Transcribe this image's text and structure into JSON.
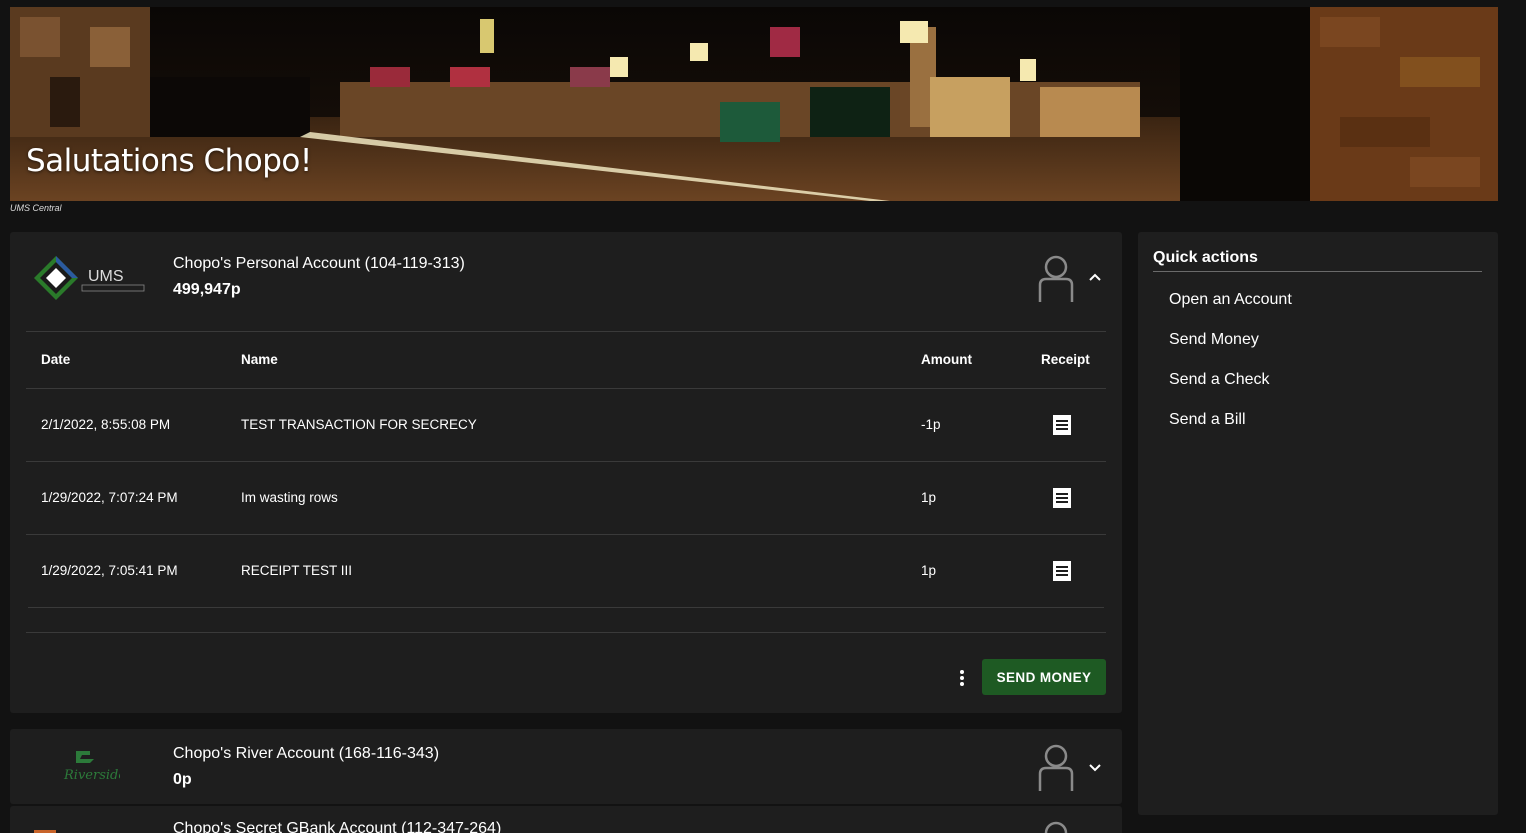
{
  "banner": {
    "title": "Salutations Chopo!",
    "caption": "UMS Central"
  },
  "accounts": [
    {
      "name": "Chopo's Personal Account (104-119-313)",
      "balance": "499,947p",
      "logo": "ums-bank-logo",
      "expanded": true,
      "columns": [
        "Date",
        "Name",
        "Amount",
        "Receipt"
      ],
      "transactions": [
        {
          "date": "2/1/2022, 8:55:08 PM",
          "name": "TEST TRANSACTION FOR SECRECY",
          "amount": "-1p",
          "receipt_icon": "receipt-icon"
        },
        {
          "date": "1/29/2022, 7:07:24 PM",
          "name": "Im wasting rows",
          "amount": "1p",
          "receipt_icon": "receipt-icon"
        },
        {
          "date": "1/29/2022, 7:05:41 PM",
          "name": "RECEIPT TEST III",
          "amount": "1p",
          "receipt_icon": "receipt-icon"
        }
      ],
      "send_money_label": "SEND MONEY"
    },
    {
      "name": "Chopo's River Account (168-116-343)",
      "balance": "0p",
      "logo": "riverside-logo",
      "expanded": false
    },
    {
      "name": "Chopo's Secret GBank Account (112-347-264)",
      "logo": "gbank-logo",
      "expanded": false
    }
  ],
  "quick_actions": {
    "title": "Quick actions",
    "items": [
      "Open an Account",
      "Send Money",
      "Send a Check",
      "Send a Bill"
    ]
  },
  "colors": {
    "background": "#121212",
    "card": "#1e1e1e",
    "button": "#1e5a23",
    "divider": "#3a3a3a"
  }
}
